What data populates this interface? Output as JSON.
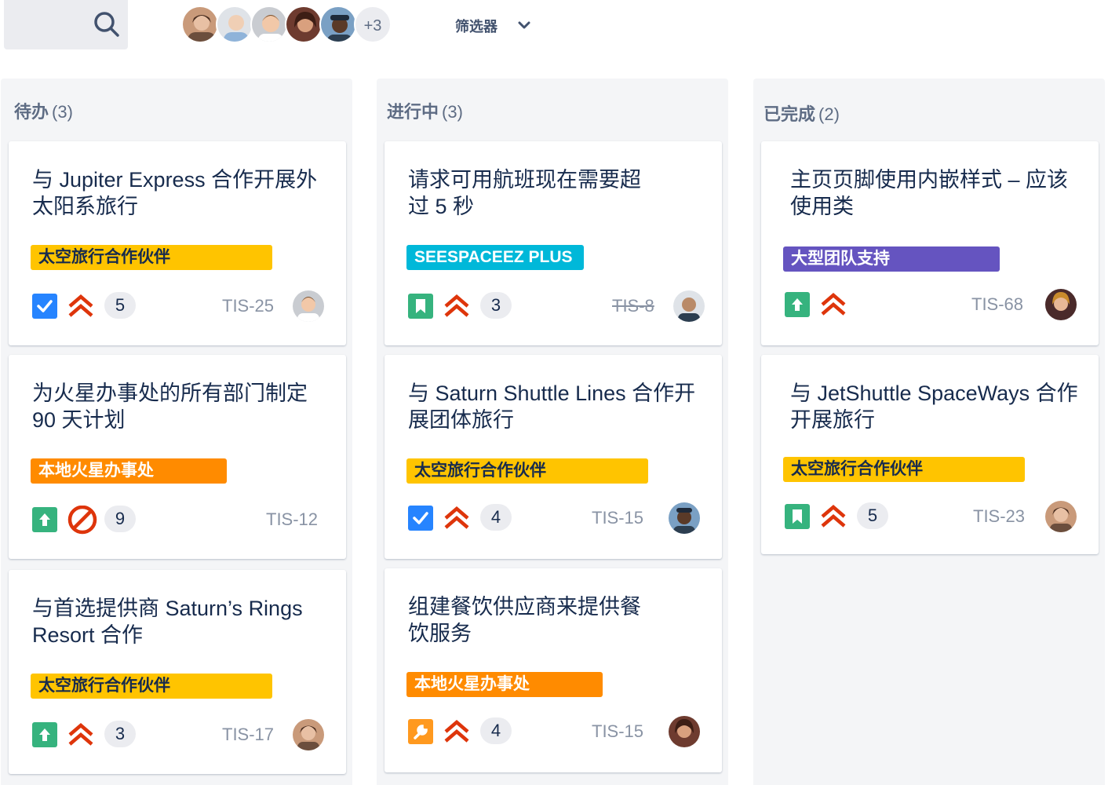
{
  "toolbar": {
    "search_icon": "search-icon",
    "avatars_more": "+3",
    "filter_label": "筛选器",
    "filter_icon": "chevron-down-icon"
  },
  "columns": [
    {
      "title": "待办",
      "count": "(3)",
      "cards": [
        {
          "title": "与 Jupiter Express 合作开展外太阳系旅行",
          "label": "太空旅行合作伙伴",
          "label_color": "#ffc400",
          "type": "task",
          "priority": "highest",
          "estimate": "5",
          "key": "TIS-25"
        },
        {
          "title": "为火星办事处的所有部门制定 90 天计划",
          "label": "本地火星办事处",
          "label_color": "#ff8b00",
          "type": "improvement",
          "priority": "blocker",
          "estimate": "9",
          "key": "TIS-12"
        },
        {
          "title": "与首选提供商 Saturn’s Rings Resort 合作",
          "label": "太空旅行合作伙伴",
          "label_color": "#ffc400",
          "type": "improvement",
          "priority": "highest",
          "estimate": "3",
          "key": "TIS-17"
        }
      ]
    },
    {
      "title": "进行中",
      "count": "(3)",
      "cards": [
        {
          "title": "请求可用航班现在需要超过 5 秒",
          "label": "SEESPACEEZ PLUS",
          "label_color": "#00b8d9",
          "type": "story",
          "priority": "highest",
          "estimate": "3",
          "key": "TIS-8"
        },
        {
          "title": "与 Saturn Shuttle Lines 合作开展团体旅行",
          "label": "太空旅行合作伙伴",
          "label_color": "#ffc400",
          "type": "task",
          "priority": "highest",
          "estimate": "4",
          "key": "TIS-15"
        },
        {
          "title": "组建餐饮供应商来提供餐饮服务",
          "label": "本地火星办事处",
          "label_color": "#ff8b00",
          "type": "subtask-wrench",
          "priority": "highest",
          "estimate": "4",
          "key": "TIS-15"
        }
      ]
    },
    {
      "title": "已完成",
      "count": "(2)",
      "cards": [
        {
          "title": "主页页脚使用内嵌样式 – 应该使用类",
          "label": "大型团队支持",
          "label_color": "#6554c0",
          "type": "improvement",
          "priority": "highest",
          "key": "TIS-68"
        },
        {
          "title": "与 JetShuttle SpaceWays 合作开展旅行",
          "label": "太空旅行合作伙伴",
          "label_color": "#ffc400",
          "type": "story",
          "priority": "highest",
          "estimate": "5",
          "key": "TIS-23"
        }
      ]
    }
  ]
}
